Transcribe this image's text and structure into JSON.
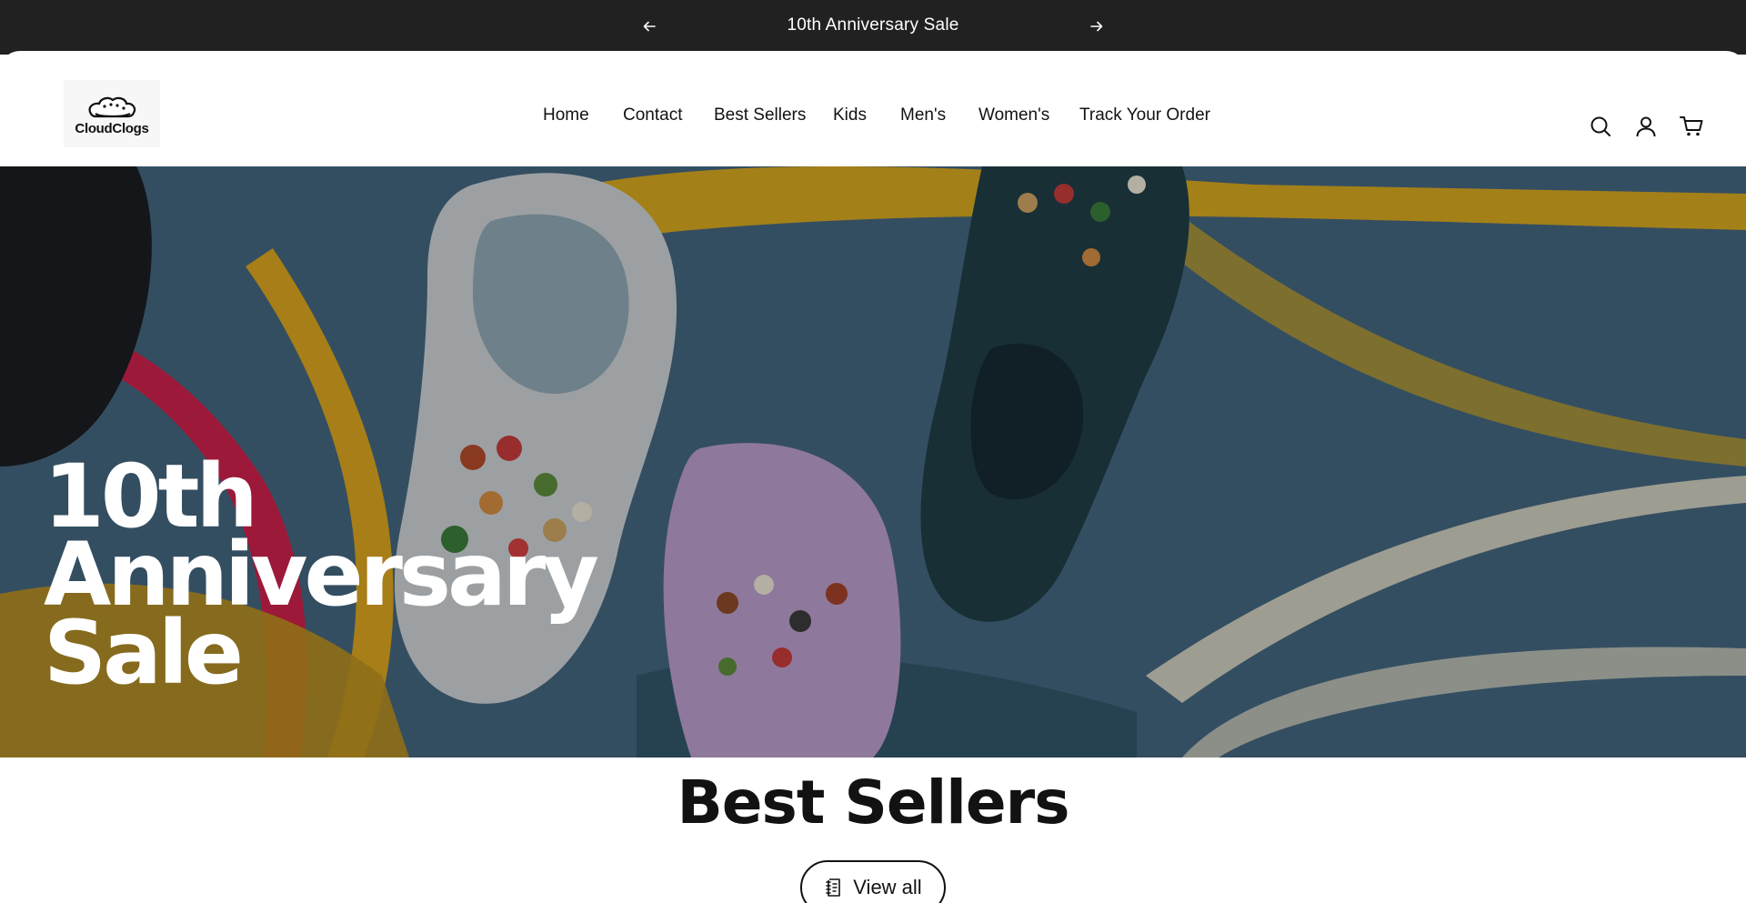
{
  "announcement": {
    "message": "10th Anniversary Sale",
    "prev_icon": "arrow-left-icon",
    "next_icon": "arrow-right-icon"
  },
  "header": {
    "logo_text": "CloudClogs",
    "nav": [
      {
        "label": "Home"
      },
      {
        "label": "Contact"
      },
      {
        "label": "Best Sellers"
      },
      {
        "label": "Kids"
      },
      {
        "label": "Men's"
      },
      {
        "label": "Women's"
      },
      {
        "label": "Track Your Order"
      }
    ],
    "icons": [
      "search-icon",
      "account-icon",
      "cart-icon"
    ]
  },
  "hero": {
    "line1": "10th",
    "line2": "Anniversary",
    "line3": "Sale"
  },
  "best_sellers": {
    "title": "Best Sellers",
    "view_all_label": "View all",
    "view_all_icon": "document-icon"
  },
  "colors": {
    "announcement_bg": "#212121",
    "text": "#121212",
    "hero_bg": "#3d5d74"
  }
}
